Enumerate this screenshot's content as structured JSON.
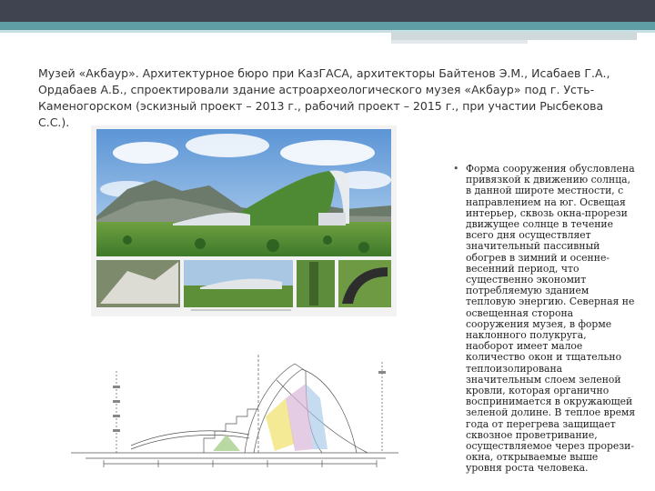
{
  "slide": {
    "title": "Музей «Акбаур». Архитектурное бюро при КазГАСА, архитекторы Байтенов Э.М., Исабаев Г.А., Ордабаев А.Б., спроектировали здание астроархеологического музея «Акбаур» под г. Усть-Каменогорском (эскизный проект – 2013 г., рабочий проект – 2015 г., при участии Рысбекова С.С.).",
    "bullet_text": "Форма сооружения обусловлена привязкой к движению солнца, в данной широте местности, с направлением на юг. Освещая интерьер, сквозь окна-прорези движущее солнце в течение всего дня осуществляет значительный пассивный обогрев в зимний и осенне-весенний период, что существенно экономит потребляемую зданием тепловую энергию. Северная не освещенная сторона сооружения музея, в форме наклонного полукруга, наоборот имеет малое количество окон и тщательно теплоизолирована значительным слоем зеленой кровли, которая органично воспринимается в окружающей зеленой долине. В теплое время года от перегрева защищает сквозное проветривание, осуществляемое через прорези-окна, открываемые выше уровня роста человека."
  },
  "colors": {
    "top_bar": "#3f4450",
    "accent_stripe": "#5e9ea4",
    "grass": "#4f8a36",
    "sky": "#7fb3e6"
  }
}
